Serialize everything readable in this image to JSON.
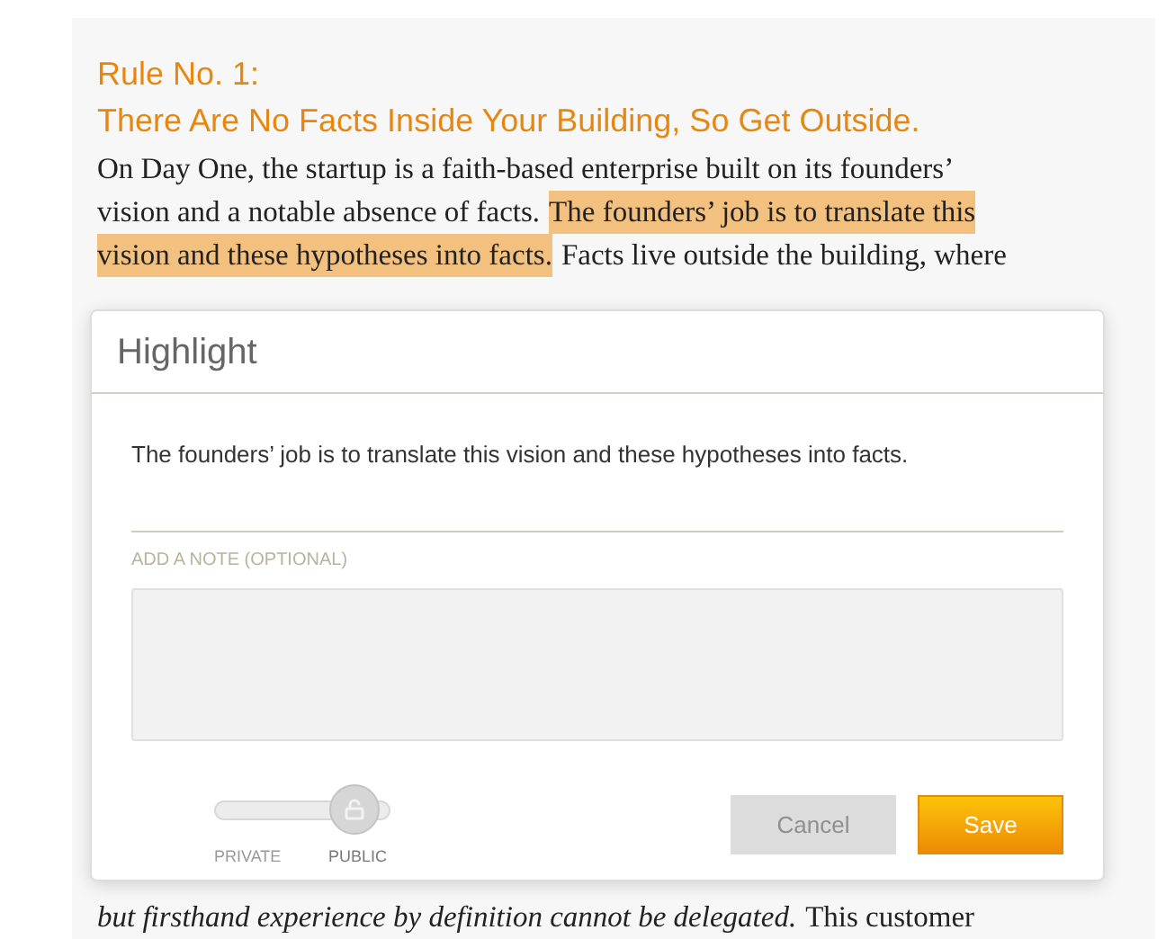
{
  "article": {
    "title_lines": [
      "Rule No. 1:",
      "There Are No Facts Inside Your Building, So Get Outside."
    ],
    "lines": [
      [
        {
          "text": "On Day One, the startup is a faith-based enterprise built on its founders’",
          "kind": "plain"
        }
      ],
      [
        {
          "text": "vision and a notable absence of facts.",
          "kind": "plain"
        },
        {
          "text": "The founders’ job is to translate this",
          "kind": "highlight"
        }
      ],
      [
        {
          "text": "vision and these hypotheses into facts.",
          "kind": "highlight"
        },
        {
          "text": "Facts live outside the building, where",
          "kind": "plain"
        }
      ]
    ],
    "bottom_lines": [
      [
        {
          "text": "but firsthand experience by definition cannot be delegated.",
          "kind": "italic"
        },
        {
          "text": "This customer",
          "kind": "plain"
        }
      ]
    ]
  },
  "dialog": {
    "title": "Highlight",
    "quote": "The founders’ job is to translate this vision and these hypotheses into facts.",
    "note_label": "ADD A NOTE (OPTIONAL)",
    "visibility": [
      {
        "label": "PRIVATE",
        "selected": false
      },
      {
        "label": "PUBLIC",
        "selected": true
      }
    ],
    "buttons": [
      {
        "label": "Cancel",
        "kind": "secondary"
      },
      {
        "label": "Save",
        "kind": "primary"
      }
    ]
  }
}
